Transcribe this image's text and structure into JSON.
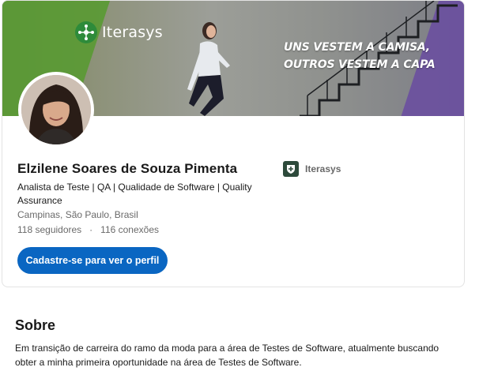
{
  "banner": {
    "brand": "Iterasys",
    "slogan_line1": "UNS VESTEM A CAMISA,",
    "slogan_line2": "OUTROS VESTEM A CAPA"
  },
  "profile": {
    "name": "Elzilene Soares de Souza Pimenta",
    "headline": "Analista de Teste | QA | Qualidade de Software | Quality Assurance",
    "location": "Campinas, São Paulo, Brasil",
    "followers": "118 seguidores",
    "separator": "·",
    "connections": "116 conexões",
    "cta_label": "Cadastre-se para ver o perfil"
  },
  "company": {
    "name": "Iterasys",
    "icon": "shield-logo-icon"
  },
  "about": {
    "title": "Sobre",
    "text": "Em transição de carreira do ramo da moda para a área de Testes de Software, atualmente buscando obter a minha primeira oportunidade na área de Testes de Software."
  },
  "colors": {
    "primary": "#0a66c2",
    "brand_green": "#5a9a34",
    "brand_purple": "#6a4fa0"
  }
}
